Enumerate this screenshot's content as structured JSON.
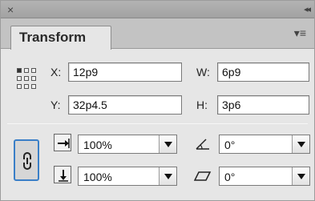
{
  "titlebar": {
    "close_glyph": "×",
    "collapse_glyph": "◂◂"
  },
  "panel": {
    "tab_label": "Transform",
    "menu_glyph": "▾≡"
  },
  "reference_point": {
    "icon": "reference-point-grid-icon",
    "selected": "top-left"
  },
  "position": {
    "x_label": "X:",
    "x_value": "12p9",
    "y_label": "Y:",
    "y_value": "32p4.5"
  },
  "size": {
    "w_label": "W:",
    "w_value": "6p9",
    "h_label": "H:",
    "h_value": "3p6"
  },
  "scale": {
    "constrain_icon": "chain-link-icon",
    "x_icon": "scale-x-arrow-icon",
    "x_value": "100%",
    "y_icon": "scale-y-arrow-icon",
    "y_value": "100%"
  },
  "rotation": {
    "icon": "rotate-angle-icon",
    "value": "0°"
  },
  "shear": {
    "icon": "shear-parallelogram-icon",
    "value": "0°"
  },
  "colors": {
    "focus_blue": "#3a7fc7",
    "panel_bg": "#e6e6e6",
    "header_bg": "#a8a8a8"
  }
}
